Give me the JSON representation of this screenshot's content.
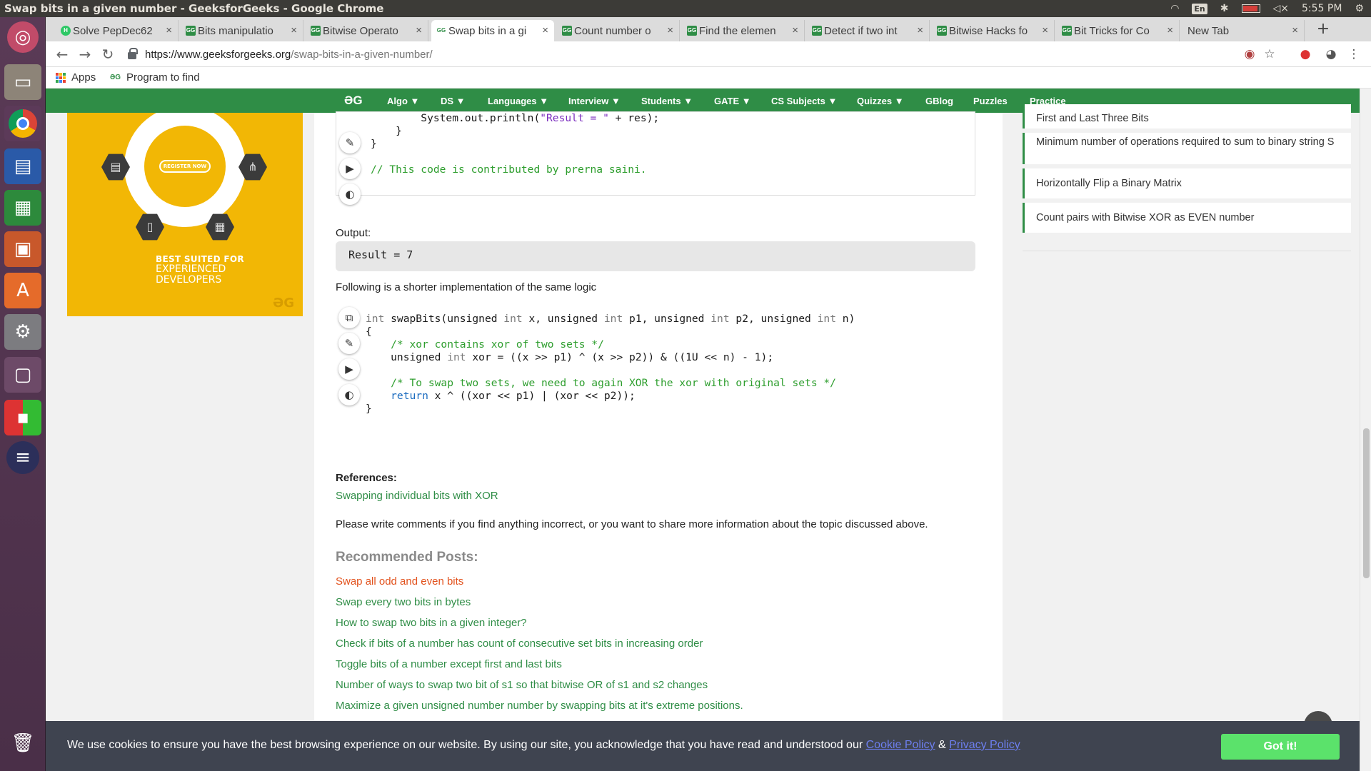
{
  "os": {
    "window_title": "Swap bits in a given number - GeeksforGeeks - Google Chrome",
    "lang": "En",
    "time": "5:55 PM"
  },
  "tabs": [
    {
      "label": "Solve PepDec62",
      "fav": "H"
    },
    {
      "label": "Bits manipulatio",
      "fav": "GG"
    },
    {
      "label": "Bitwise Operato",
      "fav": "GG"
    },
    {
      "label": "Swap bits in a gi",
      "fav": "GG"
    },
    {
      "label": "Count number o",
      "fav": "GG"
    },
    {
      "label": "Find the elemen",
      "fav": "GG"
    },
    {
      "label": "Detect if two int",
      "fav": "GG"
    },
    {
      "label": "Bitwise Hacks fo",
      "fav": "GG"
    },
    {
      "label": "Bit Tricks for Co",
      "fav": "GG"
    },
    {
      "label": "New Tab",
      "fav": ""
    }
  ],
  "address": {
    "scheme": "https://",
    "host": "www.geeksforgeeks.org",
    "path": "/swap-bits-in-a-given-number/"
  },
  "bookmarks": {
    "apps": "Apps",
    "program": "Program to find"
  },
  "gfg_nav": {
    "logo": "ƏG",
    "items": [
      "Algo ▼",
      "DS ▼",
      "Languages ▼",
      "Interview ▼",
      "Students ▼",
      "GATE ▼",
      "CS Subjects ▼",
      "Quizzes ▼",
      "GBlog",
      "Puzzles",
      "Practice"
    ]
  },
  "ad": {
    "register": "REGISTER NOW",
    "line1": "BEST SUITED FOR",
    "line2": "EXPERIENCED",
    "line3": "DEVELOPERS",
    "logo": "ƏG"
  },
  "code1": {
    "l1_pre": "        System.out.println(",
    "l1_str": "\"Result = \"",
    "l1_post": " + res);",
    "l2": "    }",
    "l3": "}",
    "l4": "// This code is contributed by prerna saini."
  },
  "output": {
    "label": "Output:",
    "value": "Result = 7"
  },
  "shorter_text": "Following is a shorter implementation of the same logic",
  "code2": {
    "l1": [
      "int",
      " swapBits(unsigned ",
      "int",
      " x, unsigned ",
      "int",
      " p1, unsigned ",
      "int",
      " p2, unsigned ",
      "int",
      " n)"
    ],
    "l2": "{",
    "l3": "    /* xor contains xor of two sets */",
    "l4_a": "    unsigned ",
    "l4_kw": "int",
    "l4_b": " xor = ((x >> p1) ^ (x >> p2)) & ((1U << n) - 1);",
    "l5": "",
    "l6": "    /* To swap two sets, we need to again XOR the xor with original sets */",
    "l7_kw": "    return",
    "l7_b": " x ^ ((xor << p1) | (xor << p2));",
    "l8": "}"
  },
  "references": {
    "label": "References:",
    "link": "Swapping individual bits with XOR"
  },
  "comments_text": "Please write comments if you find anything incorrect, or you want to share more information about the topic discussed above.",
  "recommended": {
    "title": "Recommended Posts:",
    "posts": [
      "Swap all odd and even bits",
      "Swap every two bits in bytes",
      "How to swap two bits in a given integer?",
      "Check if bits of a number has count of consecutive set bits in increasing order",
      "Toggle bits of a number except first and last bits",
      "Number of ways to swap two bit of s1 so that bitwise OR of s1 and s2 changes",
      "Maximize a given unsigned number number by swapping bits at it's extreme positions."
    ]
  },
  "sidebar": {
    "items": [
      "First and Last Three Bits",
      "Minimum number of operations required to sum to binary string S",
      "Horizontally Flip a Binary Matrix",
      "Count pairs with Bitwise XOR as EVEN number"
    ]
  },
  "cookie": {
    "text": "We use cookies to ensure you have the best browsing experience on our website. By using our site, you acknowledge that you have read and understood our",
    "cookie_policy": "Cookie Policy",
    "amp": "&",
    "privacy_policy": "Privacy Policy",
    "button": "Got it!"
  },
  "colors": {
    "gfg_green": "#2f8d46",
    "cookie_bg": "#3f4450",
    "gotit_green": "#5be26b",
    "ad_yellow": "#f2b705",
    "highlight_link": "#e2521d"
  },
  "icons": [
    "ubuntu-logo-icon",
    "files-icon",
    "chrome-icon",
    "writer-icon",
    "calc-icon",
    "impress-icon",
    "software-center-icon",
    "settings-icon",
    "workspace-icon",
    "rubik-icon",
    "eclipse-icon",
    "trash-icon",
    "copy-icon",
    "edit-icon",
    "run-icon",
    "theme-icon",
    "lock-icon",
    "star-icon",
    "profile-icon"
  ]
}
